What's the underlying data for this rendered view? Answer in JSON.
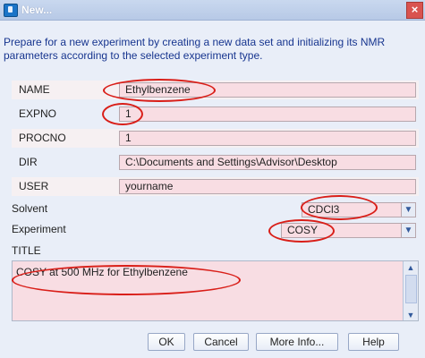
{
  "window": {
    "title": "New...",
    "icon": "app-window-icon",
    "close_label": "×"
  },
  "description": "Prepare for a new experiment by creating a new data set and initializing its NMR parameters according to the selected experiment type.",
  "fields": [
    {
      "label": "NAME",
      "value": "Ethylbenzene"
    },
    {
      "label": "EXPNO",
      "value": "1"
    },
    {
      "label": "PROCNO",
      "value": "1"
    },
    {
      "label": "DIR",
      "value": "C:\\Documents and Settings\\Advisor\\Desktop"
    },
    {
      "label": "USER",
      "value": "yourname"
    }
  ],
  "solvent": {
    "label": "Solvent",
    "value": "CDCl3"
  },
  "experiment": {
    "label": "Experiment",
    "value": "COSY"
  },
  "title_label": "TITLE",
  "title_text": "COSY at 500 MHz for Ethylbenzene",
  "buttons": {
    "ok": "OK",
    "cancel": "Cancel",
    "more_info": "More Info...",
    "help": "Help"
  },
  "colors": {
    "accent": "#17358f",
    "field_bg": "#f8dde3",
    "highlight_oval": "#d91e18"
  }
}
